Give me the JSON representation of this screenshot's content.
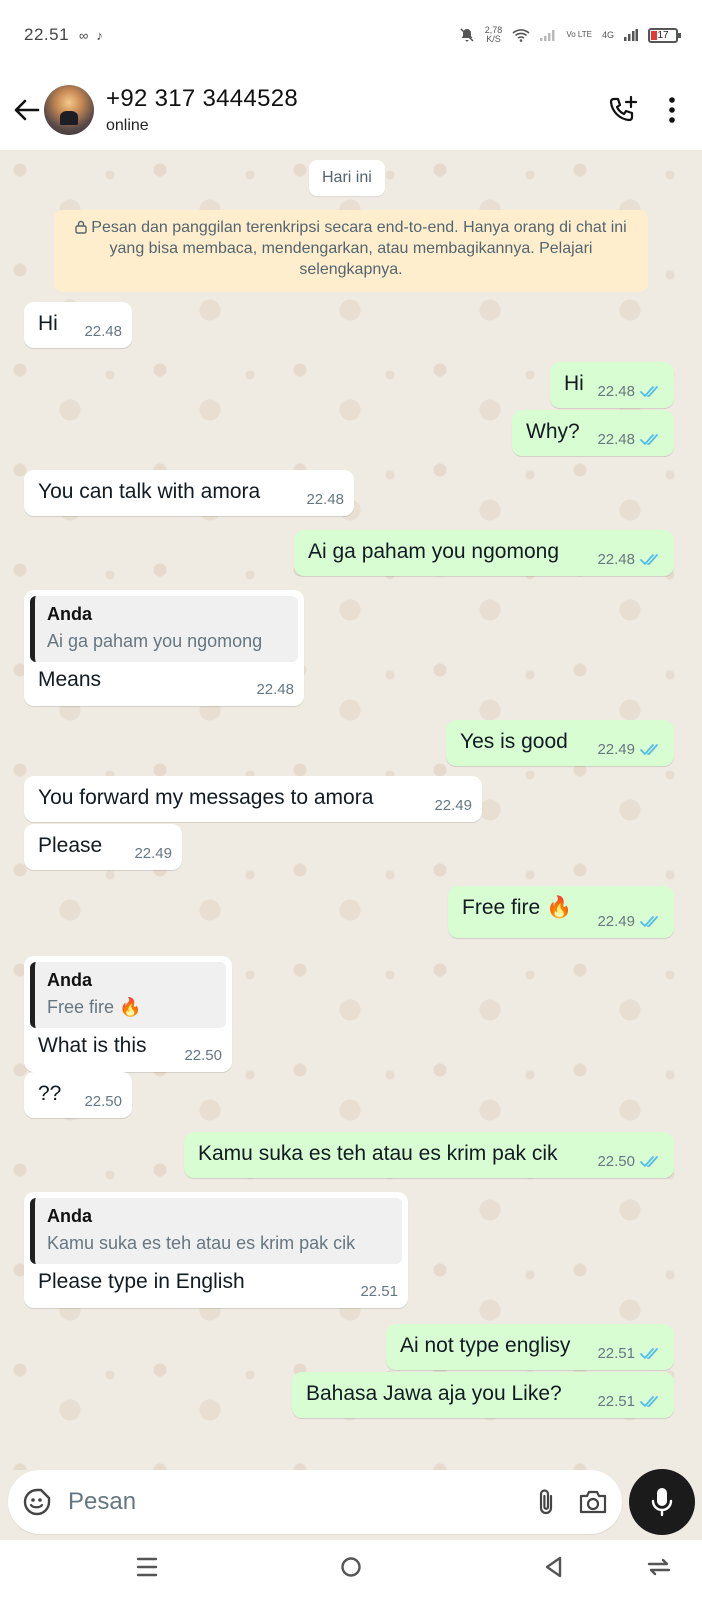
{
  "status_bar": {
    "time": "22.51",
    "speed": "2,78",
    "speed_unit": "K/S",
    "network": "4G",
    "volte": "Vo LTE",
    "battery": "17"
  },
  "header": {
    "contact_name": "+92 317 3444528",
    "contact_status": "online"
  },
  "chat": {
    "date_chip": "Hari ini",
    "notice": "Pesan dan panggilan terenkripsi secara end-to-end. Hanya orang di chat ini yang bisa membaca, mendengarkan, atau membagikannya. Pelajari selengkapnya.",
    "messages": [
      {
        "dir": "in",
        "text": "Hi",
        "time": "22.48"
      },
      {
        "dir": "out",
        "text": "Hi",
        "time": "22.48"
      },
      {
        "dir": "out",
        "text": "Why?",
        "time": "22.48"
      },
      {
        "dir": "in",
        "text": "You can talk with amora",
        "time": "22.48"
      },
      {
        "dir": "out",
        "text": "Ai ga paham you ngomong",
        "time": "22.48"
      },
      {
        "dir": "in",
        "quote_author": "Anda",
        "quote_text": "Ai ga paham you ngomong",
        "text": "Means",
        "time": "22.48"
      },
      {
        "dir": "out",
        "text": "Yes is good",
        "time": "22.49"
      },
      {
        "dir": "in",
        "text": "You forward my messages to amora",
        "time": "22.49"
      },
      {
        "dir": "in",
        "text": "Please",
        "time": "22.49"
      },
      {
        "dir": "out",
        "text": "Free fire 🔥",
        "time": "22.49"
      },
      {
        "dir": "in",
        "quote_author": "Anda",
        "quote_text": "Free fire 🔥",
        "text": "What is this",
        "time": "22.50"
      },
      {
        "dir": "in",
        "text": "??",
        "time": "22.50"
      },
      {
        "dir": "out",
        "text": "Kamu suka es teh atau es krim pak cik",
        "time": "22.50"
      },
      {
        "dir": "in",
        "quote_author": "Anda",
        "quote_text": "Kamu suka es teh atau es krim pak cik",
        "text": "Please type in English",
        "time": "22.51"
      },
      {
        "dir": "out",
        "text": "Ai not type englisy",
        "time": "22.51"
      },
      {
        "dir": "out",
        "text": "Bahasa Jawa aja you Like?",
        "time": "22.51"
      }
    ]
  },
  "input": {
    "placeholder": "Pesan"
  },
  "colors": {
    "incoming_bubble": "#ffffff",
    "outgoing_bubble": "#d9fdd3",
    "read_tick": "#53bdeb",
    "chat_background": "#efeae2",
    "notice_background": "#ffeecd"
  }
}
